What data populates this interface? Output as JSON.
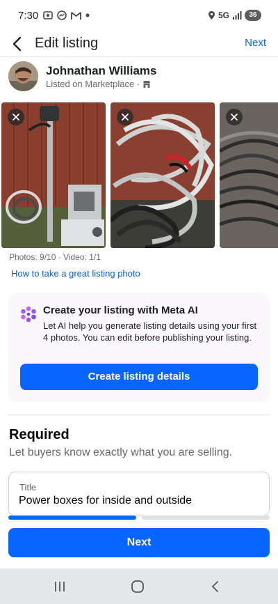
{
  "status_bar": {
    "time": "7:30",
    "network": "5G",
    "battery": "36",
    "icons": [
      "screenshot-icon",
      "messenger-icon",
      "gmail-icon",
      "dot-icon",
      "location-icon",
      "signal-icon"
    ]
  },
  "header": {
    "title": "Edit listing",
    "next_label": "Next",
    "back_icon": "back-arrow-icon"
  },
  "seller": {
    "name": "Johnathan Williams",
    "subtitle": "Listed on Marketplace ·",
    "shop_icon": "marketplace-icon"
  },
  "photos": {
    "items": [
      {
        "description": "electrical panel and cables",
        "remove_icon": "close-icon"
      },
      {
        "description": "coiled wires",
        "remove_icon": "close-icon"
      },
      {
        "description": "black cables",
        "remove_icon": "close-icon"
      }
    ],
    "meta": "Photos: 9/10 · Video: 1/1",
    "tip_link": "How to take a great listing photo"
  },
  "ai_card": {
    "title": "Create your listing with Meta AI",
    "description": "Let AI help you generate listing details using your first 4 photos. You can edit before publishing your listing.",
    "button_label": "Create listing details",
    "icon": "meta-ai-icon"
  },
  "required": {
    "title": "Required",
    "subtitle": "Let buyers know exactly what you are selling."
  },
  "title_field": {
    "label": "Title",
    "value": "Power boxes for inside and outside"
  },
  "progress": {
    "current_step": 1,
    "total_steps": 2
  },
  "footer": {
    "next_label": "Next"
  },
  "colors": {
    "accent": "#0866ff",
    "link": "#0a67d6",
    "ai_card_bg": "#fbf8fd"
  }
}
